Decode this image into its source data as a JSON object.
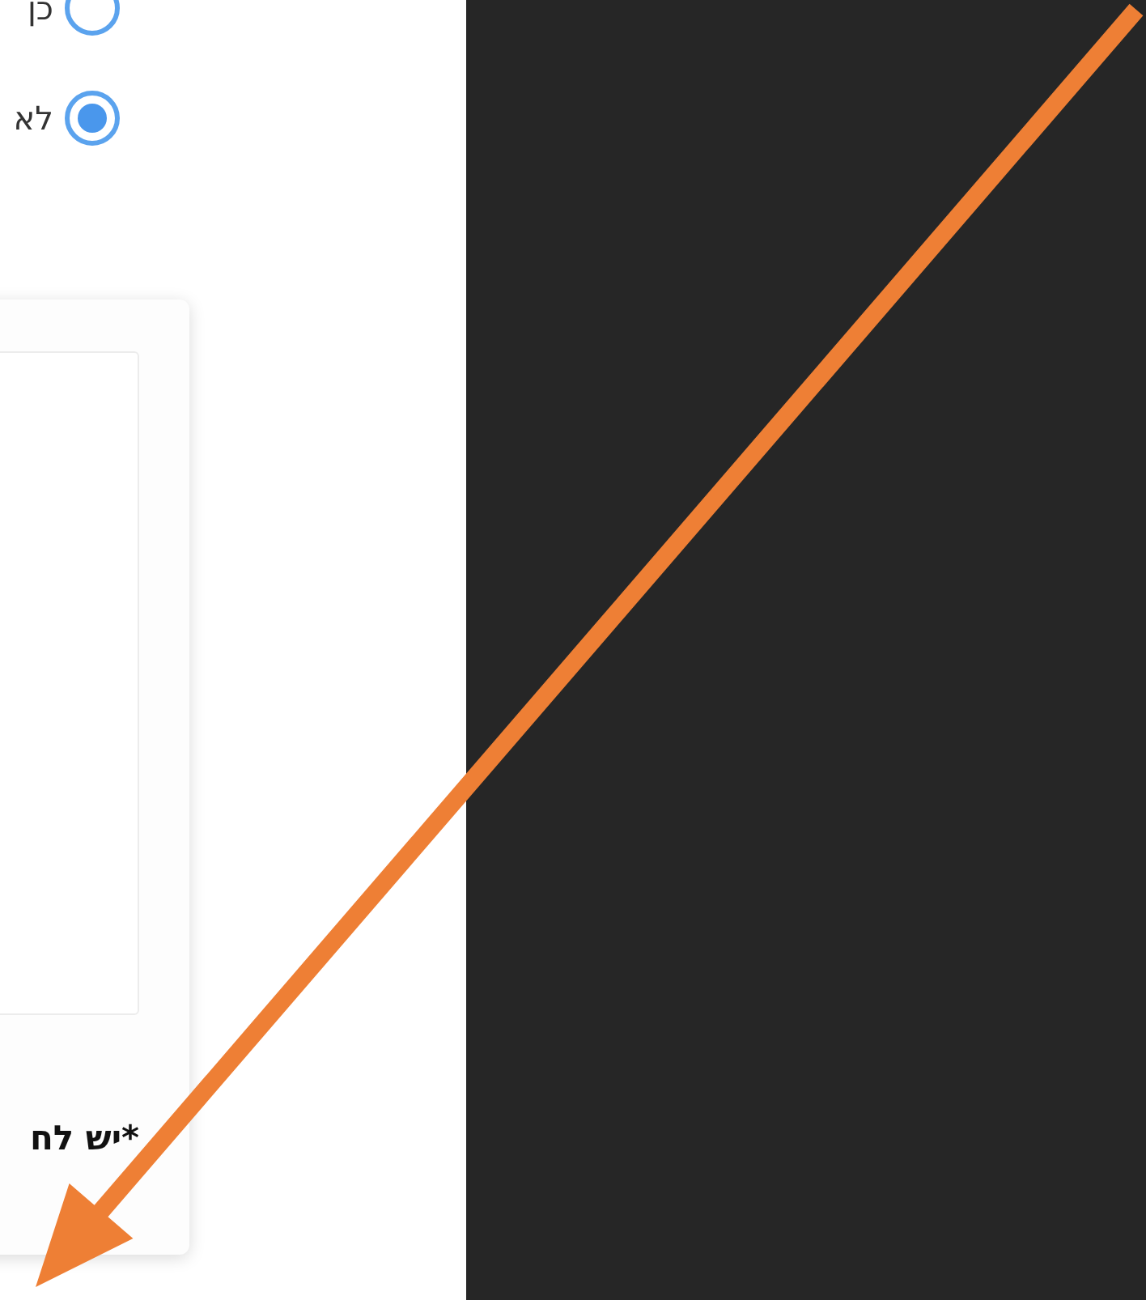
{
  "options": [
    {
      "label": "כן",
      "selected": false
    },
    {
      "label": "לא",
      "selected": true
    }
  ],
  "note": "*יש לח",
  "annotations": [
    {
      "kind": "arrow"
    }
  ]
}
